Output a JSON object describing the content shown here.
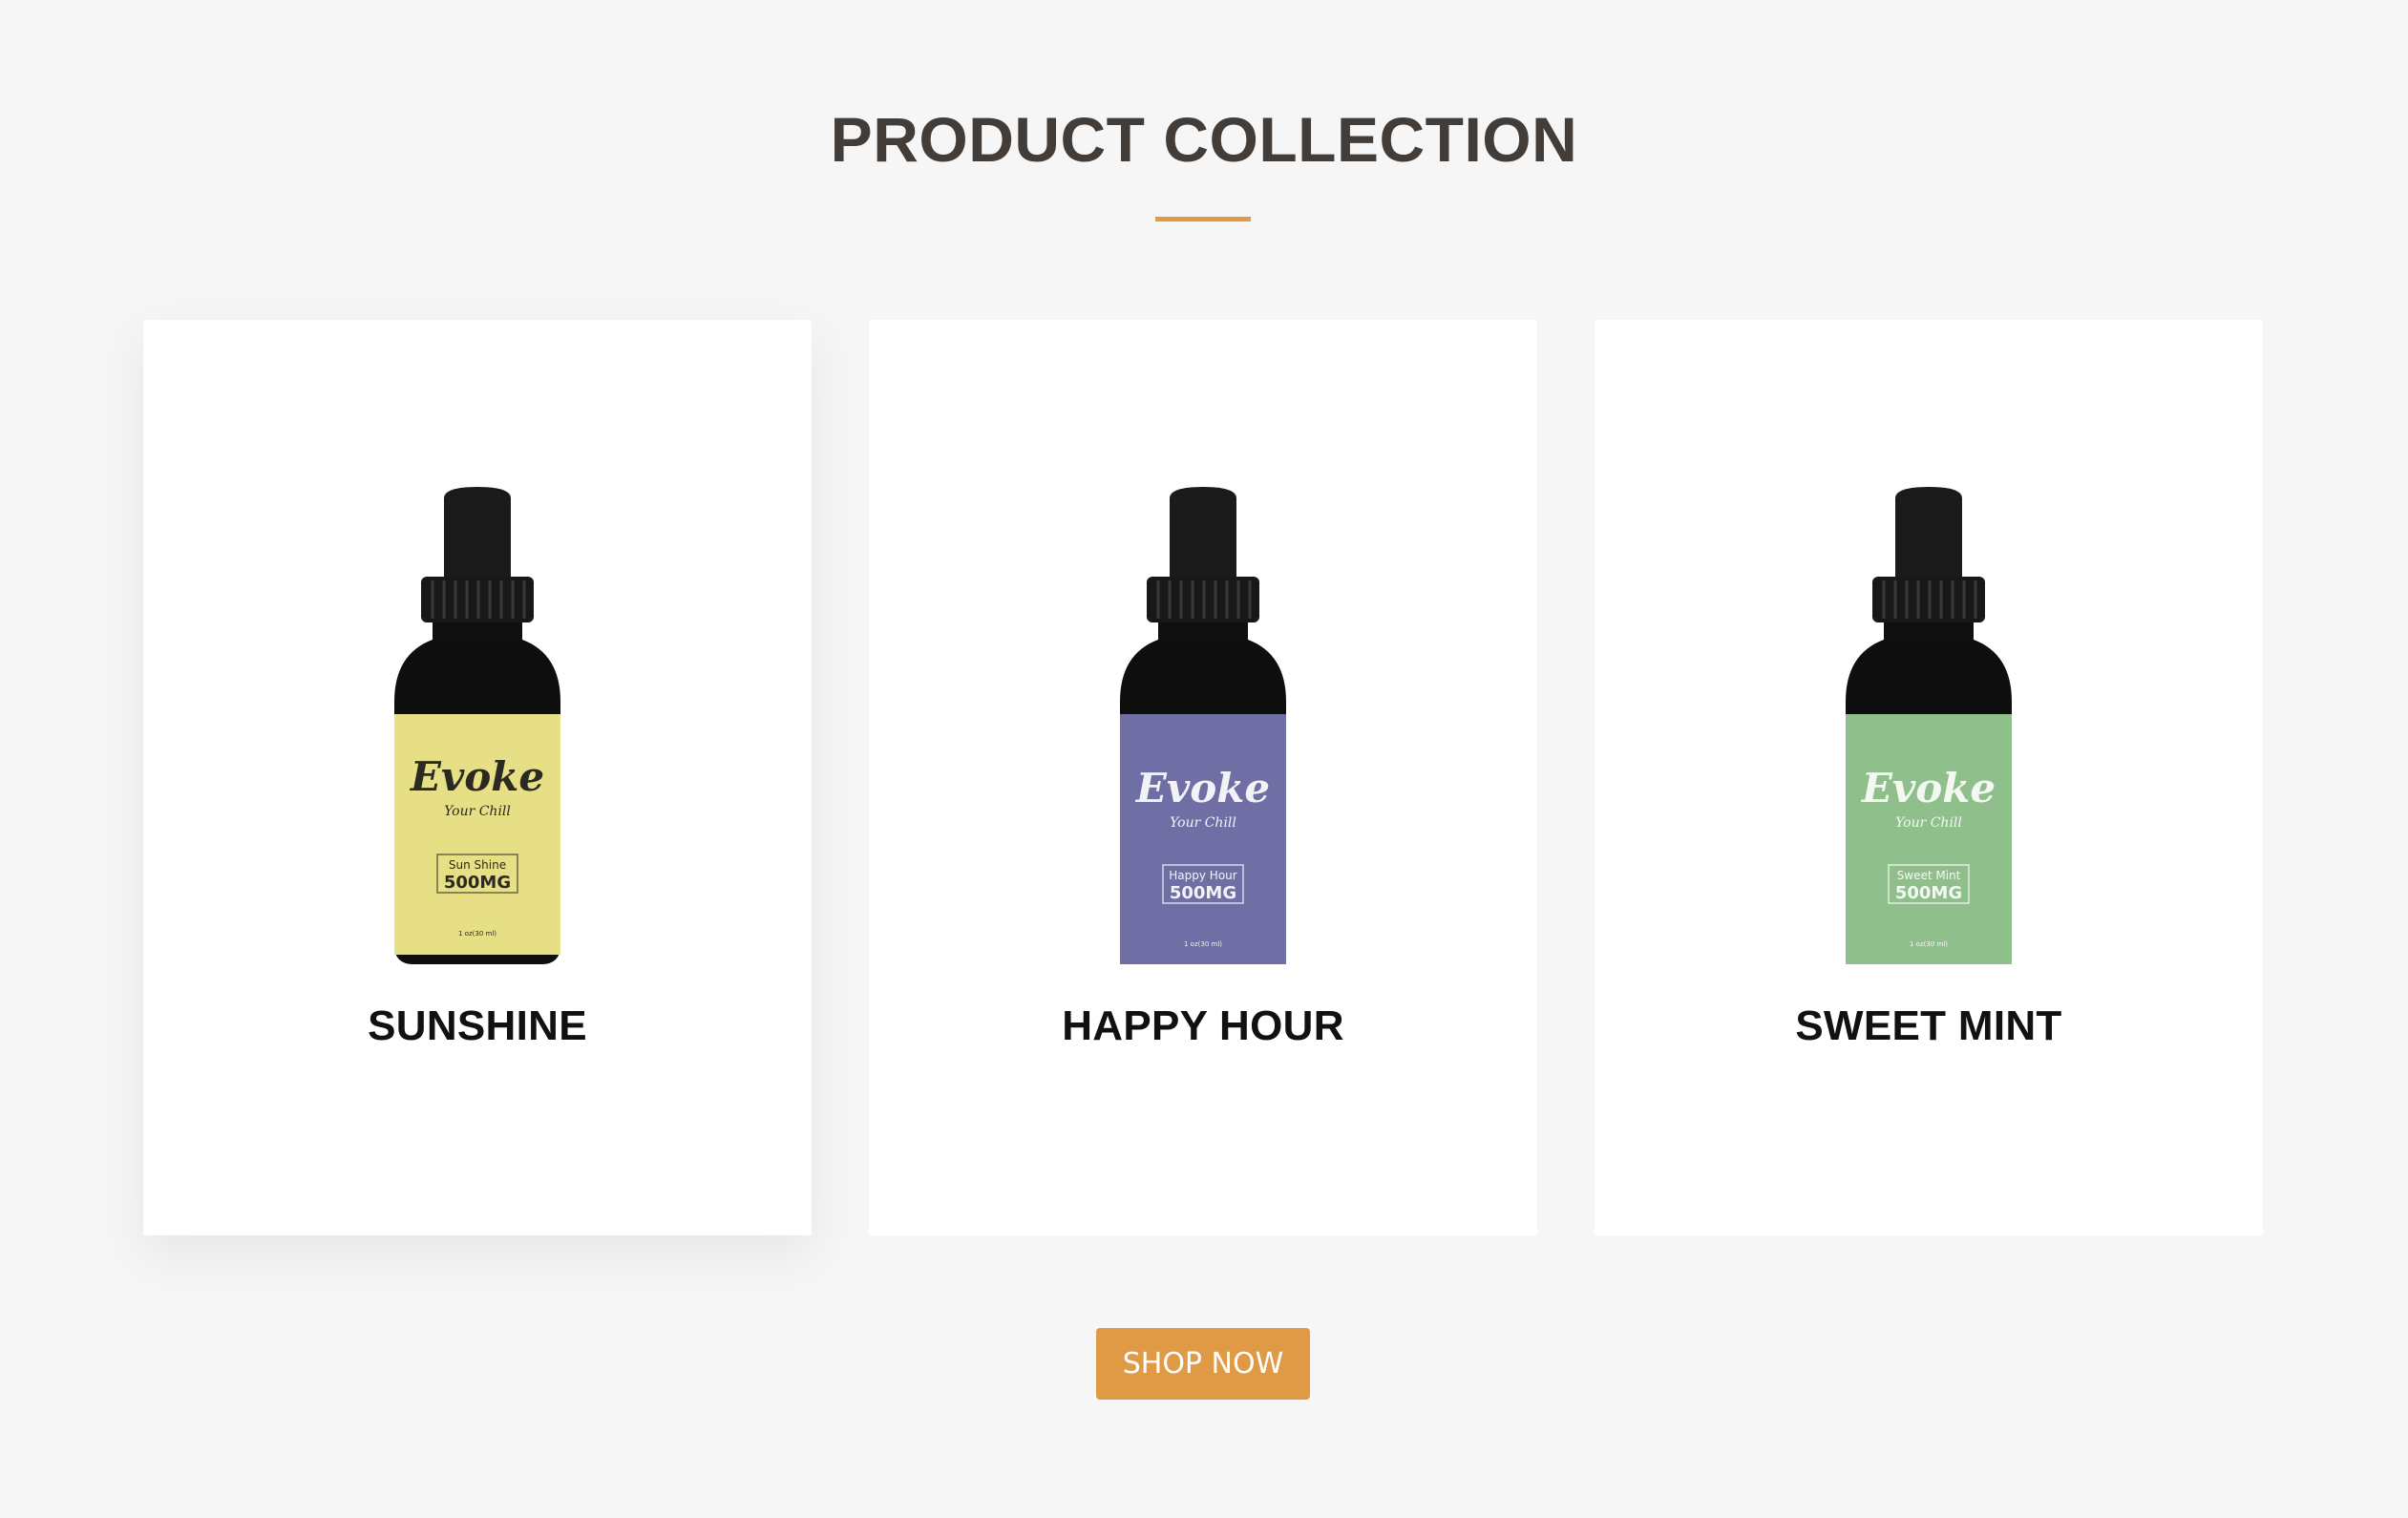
{
  "section": {
    "title": "PRODUCT COLLECTION",
    "accent_color": "#e09a45"
  },
  "products": [
    {
      "name": "SUNSHINE",
      "label_color": "#e6df85",
      "label_ink": "#2b2a20",
      "brand": "Evoke",
      "tagline": "Your Chill",
      "flavor": "Sun Shine",
      "strength": "500MG",
      "volume": "1 oz(30 ml)"
    },
    {
      "name": "HAPPY HOUR",
      "label_color": "#6f6fa6",
      "label_ink": "#f2f2f7",
      "brand": "Evoke",
      "tagline": "Your Chill",
      "flavor": "Happy Hour",
      "strength": "500MG",
      "volume": "1 oz(30 ml)"
    },
    {
      "name": "SWEET MINT",
      "label_color": "#8fc08b",
      "label_ink": "#f4f8f2",
      "brand": "Evoke",
      "tagline": "Your Chill",
      "flavor": "Sweet Mint",
      "strength": "500MG",
      "volume": "1 oz(30 ml)"
    }
  ],
  "cta": {
    "label": "SHOP NOW",
    "color": "#e09a45"
  }
}
